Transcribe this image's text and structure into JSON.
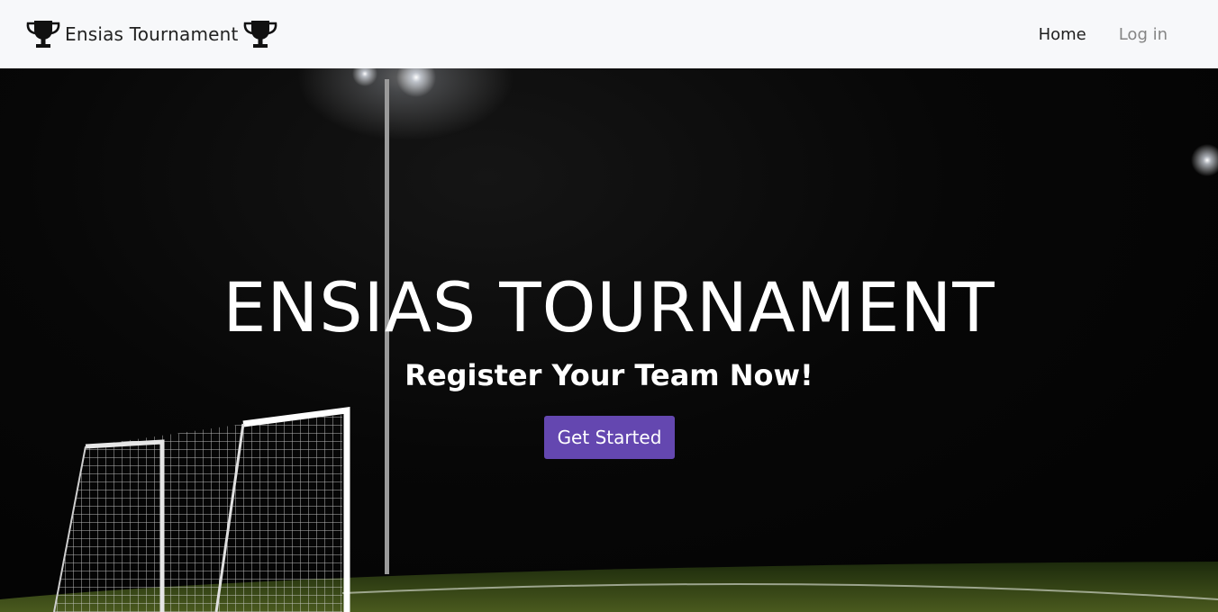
{
  "navbar": {
    "brand": "Ensias Tournament",
    "brand_icon": "trophy-icon",
    "links": [
      {
        "label": "Home",
        "state": "active"
      },
      {
        "label": "Log in",
        "state": "inactive"
      }
    ]
  },
  "hero": {
    "title": "ENSIAS TOURNAMENT",
    "subtitle": "Register Your Team Now!",
    "cta_label": "Get Started",
    "cta_color": "#6447b0"
  }
}
